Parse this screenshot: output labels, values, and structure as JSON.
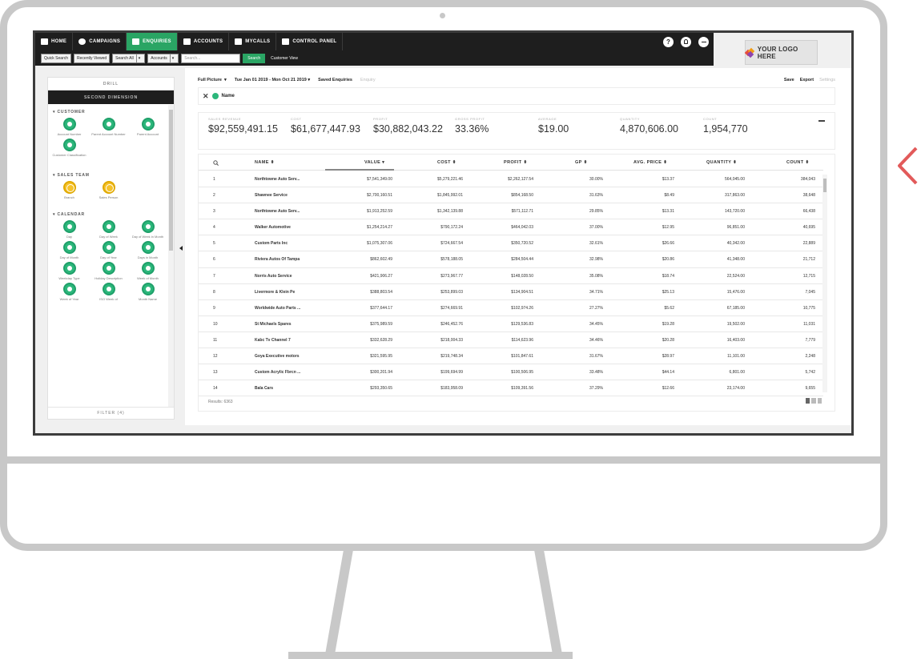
{
  "nav": {
    "items": [
      {
        "label": "HOME",
        "icon": "home-icon",
        "active": false
      },
      {
        "label": "CAMPAIGNS",
        "icon": "campaigns-icon",
        "active": false
      },
      {
        "label": "ENQUIRIES",
        "icon": "enquiries-icon",
        "active": true
      },
      {
        "label": "ACCOUNTS",
        "icon": "bank-icon",
        "active": false
      },
      {
        "label": "MYCALLS",
        "icon": "calls-icon",
        "active": false
      },
      {
        "label": "CONTROL PANEL",
        "icon": "control-panel-icon",
        "active": false
      }
    ],
    "right_icons": [
      "help-icon",
      "user-icon",
      "logout-icon"
    ],
    "help_glyph": "?"
  },
  "subbar": {
    "quick_search": "Quick Search",
    "recently_viewed": "Recently Viewed",
    "search_all": "Search All",
    "accounts": "Accounts",
    "search_placeholder": "Search...",
    "search_button": "Search",
    "customer_view": "Customer View"
  },
  "logo": {
    "text": "YOUR LOGO HERE"
  },
  "sidebar": {
    "drill": "DRILL",
    "second_dimension": "SECOND DIMENSION",
    "sections": [
      {
        "title": "CUSTOMER",
        "color": "green",
        "items": [
          "Account Number",
          "Parent Account Number",
          "Parent Account",
          "Customer Classification"
        ]
      },
      {
        "title": "SALES TEAM",
        "color": "yellow",
        "items": [
          "Branch",
          "Sales Person"
        ]
      },
      {
        "title": "CALENDAR",
        "color": "green",
        "items": [
          "Day",
          "Day of Week",
          "Day of Week in Month",
          "Day of Month",
          "Day of Year",
          "Days in Month",
          "Weekday Type",
          "Holiday Description",
          "Week of Month",
          "Week of Year",
          "ISO Week of",
          "Month Name"
        ]
      }
    ],
    "filter": "FILTER (4)"
  },
  "toolbar": {
    "full_picture": "Full Picture",
    "date_range": "Tue Jan 01 2019 - Mon Oct 21 2019",
    "saved_enquiries": "Saved Enquiries",
    "enquiry": "Enquiry",
    "save": "Save",
    "export": "Export",
    "settings": "Settings"
  },
  "chip": {
    "label": "Name"
  },
  "kpis": [
    {
      "label": "SALES REVENUE",
      "value": "$92,559,491.15"
    },
    {
      "label": "COST",
      "value": "$61,677,447.93"
    },
    {
      "label": "PROFIT",
      "value": "$30,882,043.22"
    },
    {
      "label": "GROSS PROFIT",
      "value": "33.36%"
    },
    {
      "label": "AVERAGE",
      "value": "$19.00"
    },
    {
      "label": "QUANTITY",
      "value": "4,870,606.00"
    },
    {
      "label": "COUNT",
      "value": "1,954,770"
    }
  ],
  "table": {
    "columns": [
      "NAME",
      "VALUE",
      "COST",
      "PROFIT",
      "GP",
      "AVG. PRICE",
      "QUANTITY",
      "COUNT"
    ],
    "sort_glyph": "⬍",
    "sort_desc_glyph": "▾",
    "rows": [
      [
        "1",
        "Northtowne Auto Serv...",
        "$7,541,349.00",
        "$5,279,221.46",
        "$2,262,127.54",
        "30.00%",
        "$13.37",
        "564,045.00",
        "384,043"
      ],
      [
        "2",
        "Shawnee Service",
        "$2,700,160.51",
        "$1,845,992.01",
        "$854,168.50",
        "31.63%",
        "$8.49",
        "317,863.00",
        "38,648"
      ],
      [
        "3",
        "Northtowne Auto Serv...",
        "$1,913,252.59",
        "$1,342,139.88",
        "$571,112.71",
        "29.85%",
        "$13.31",
        "143,720.00",
        "66,438"
      ],
      [
        "4",
        "Walker Automotive",
        "$1,254,214.27",
        "$790,172.24",
        "$464,042.03",
        "37.00%",
        "$12.95",
        "96,851.00",
        "40,695"
      ],
      [
        "5",
        "Custom Parts Inc",
        "$1,075,307.06",
        "$724,667.54",
        "$350,720.52",
        "32.61%",
        "$26.66",
        "40,342.00",
        "22,889"
      ],
      [
        "6",
        "Riviera Autos Of Tampa",
        "$862,602.49",
        "$578,188.05",
        "$284,504.44",
        "32.98%",
        "$20.86",
        "41,348.00",
        "21,712"
      ],
      [
        "7",
        "Norris Auto Service",
        "$421,906.27",
        "$273,967.77",
        "$148,028.50",
        "35.08%",
        "$18.74",
        "22,524.00",
        "12,715"
      ],
      [
        "8",
        "Livermore & Klein Pe",
        "$388,803.54",
        "$253,899.03",
        "$134,904.51",
        "34.71%",
        "$25.13",
        "15,476.00",
        "7,045"
      ],
      [
        "9",
        "Worldwide Auto Parts ...",
        "$377,644.17",
        "$274,669.91",
        "$102,974.26",
        "27.27%",
        "$5.62",
        "67,185.00",
        "10,775"
      ],
      [
        "10",
        "St Michaels Spares",
        "$375,989.59",
        "$246,452.76",
        "$129,536.83",
        "34.45%",
        "$19.28",
        "19,502.00",
        "11,031"
      ],
      [
        "11",
        "Kabc Tv Channel 7",
        "$332,628.29",
        "$218,004.33",
        "$114,623.96",
        "34.46%",
        "$20.28",
        "16,403.00",
        "7,779"
      ],
      [
        "12",
        "Goya Executive motors",
        "$321,595.95",
        "$219,748.34",
        "$101,847.61",
        "31.67%",
        "$28.97",
        "11,101.00",
        "2,248"
      ],
      [
        "13",
        "Custom Acrylic Fbrcn ...",
        "$300,201.94",
        "$199,694.99",
        "$100,506.95",
        "33.48%",
        "$44.14",
        "6,801.00",
        "5,742"
      ],
      [
        "14",
        "Bala Cars",
        "$293,350.65",
        "$183,958.09",
        "$109,391.56",
        "37.29%",
        "$12.66",
        "23,174.00",
        "9,655"
      ]
    ],
    "results": "Results: 6363"
  },
  "colors": {
    "accent": "#2aa564",
    "dark": "#1e1e1e",
    "sidebar_green": "#2cb77b",
    "sidebar_yellow": "#f6c22a",
    "side_arrow": "#e25a5a"
  }
}
